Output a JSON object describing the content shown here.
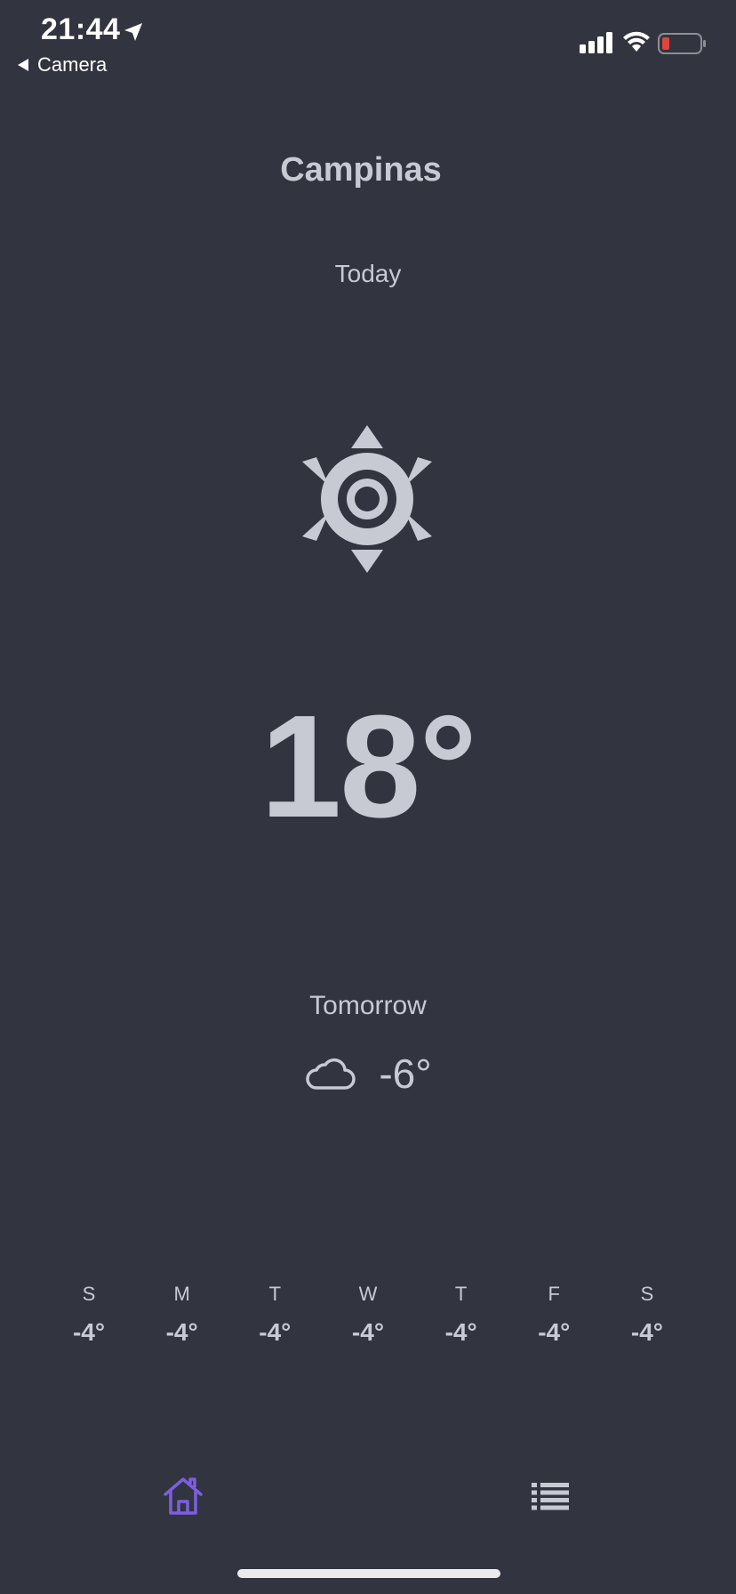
{
  "status_bar": {
    "time": "21:44",
    "back_label": "Camera"
  },
  "weather": {
    "city": "Campinas",
    "today_label": "Today",
    "today_icon": "sun-icon",
    "today_temp": "18°",
    "tomorrow_label": "Tomorrow",
    "tomorrow_icon": "cloud-icon",
    "tomorrow_temp": "-6°"
  },
  "week": [
    {
      "day": "S",
      "temp": "-4°"
    },
    {
      "day": "M",
      "temp": "-4°"
    },
    {
      "day": "T",
      "temp": "-4°"
    },
    {
      "day": "W",
      "temp": "-4°"
    },
    {
      "day": "T",
      "temp": "-4°"
    },
    {
      "day": "F",
      "temp": "-4°"
    },
    {
      "day": "S",
      "temp": "-4°"
    }
  ],
  "tab_bar": {
    "items": [
      {
        "icon": "home-icon",
        "active": true
      },
      {
        "icon": "list-icon",
        "active": false
      }
    ],
    "active_color": "#7b5fe0",
    "inactive_color": "#c8cad3"
  },
  "colors": {
    "background": "#32343f",
    "text": "#c8cad3",
    "battery_low": "#e0443b"
  }
}
